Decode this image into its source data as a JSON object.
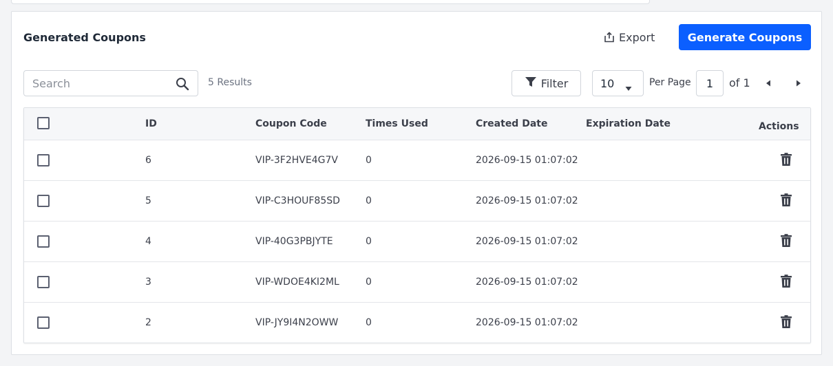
{
  "card": {
    "title": "Generated Coupons",
    "export_label": "Export",
    "generate_label": "Generate Coupons"
  },
  "toolbar": {
    "search_placeholder": "Search",
    "results": "5 Results",
    "filter_label": "Filter",
    "per_page_value": "10",
    "per_page_label": "Per Page",
    "page_value": "1",
    "of_label": "of 1"
  },
  "table": {
    "headers": {
      "id": "ID",
      "code": "Coupon Code",
      "used": "Times Used",
      "created": "Created Date",
      "expiration": "Expiration Date",
      "actions": "Actions"
    },
    "rows": [
      {
        "id": "6",
        "code": "VIP-3F2HVE4G7V",
        "used": "0",
        "created": "2026-09-15 01:07:02",
        "expiration": ""
      },
      {
        "id": "5",
        "code": "VIP-C3HOUF85SD",
        "used": "0",
        "created": "2026-09-15 01:07:02",
        "expiration": ""
      },
      {
        "id": "4",
        "code": "VIP-40G3PBJYTE",
        "used": "0",
        "created": "2026-09-15 01:07:02",
        "expiration": ""
      },
      {
        "id": "3",
        "code": "VIP-WDOE4KI2ML",
        "used": "0",
        "created": "2026-09-15 01:07:02",
        "expiration": ""
      },
      {
        "id": "2",
        "code": "VIP-JY9I4N2OWW",
        "used": "0",
        "created": "2026-09-15 01:07:02",
        "expiration": ""
      }
    ]
  },
  "icons": {
    "export": "export-icon",
    "search": "search-icon",
    "filter": "filter-icon",
    "caret": "caret-down-icon",
    "prev": "caret-left-icon",
    "next": "caret-right-icon",
    "delete": "trash-icon"
  },
  "colors": {
    "primary": "#0b5fff",
    "border": "#dcdfe4",
    "header_bg": "#f6f7f9"
  }
}
